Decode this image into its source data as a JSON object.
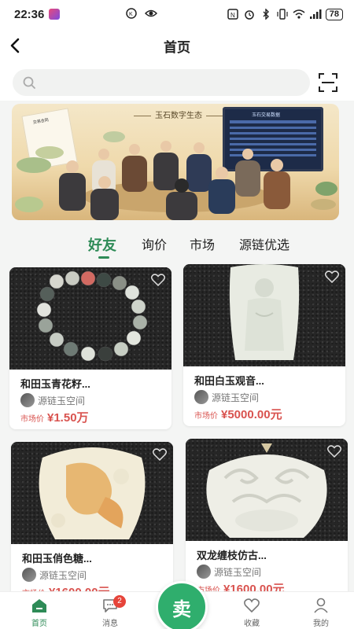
{
  "status_bar": {
    "time": "22:36",
    "battery": "78"
  },
  "nav": {
    "title": "首页"
  },
  "search": {
    "placeholder": ""
  },
  "banner": {
    "title": "玉石数字生态",
    "screen_title": "玉石交易数据",
    "doc_title": "交易合同"
  },
  "tabs": [
    {
      "label": "好友",
      "active": true
    },
    {
      "label": "询价",
      "active": false
    },
    {
      "label": "市场",
      "active": false
    },
    {
      "label": "源链优选",
      "active": false
    }
  ],
  "products": [
    {
      "title": "和田玉青花籽...",
      "shop": "源链玉空间",
      "price_label": "市场价",
      "price": "¥1.50万"
    },
    {
      "title": "和田白玉观音...",
      "shop": "源链玉空间",
      "price_label": "市场价",
      "price": "¥5000.00元"
    },
    {
      "title": "和田玉俏色糖...",
      "shop": "源链玉空间",
      "price_label": "市场价",
      "price": "¥1600.00元"
    },
    {
      "title": "双龙缠枝仿古...",
      "shop": "源链玉空间",
      "price_label": "市场价",
      "price": "¥1600.00元"
    }
  ],
  "bottom_nav": {
    "home": "首页",
    "messages": "消息",
    "messages_badge": "2",
    "sell": "卖",
    "favorites": "收藏",
    "mine": "我的"
  },
  "colors": {
    "accent": "#2e8b57",
    "price": "#d9534f",
    "sell_button": "#2fae6d",
    "badge": "#e6443a"
  }
}
